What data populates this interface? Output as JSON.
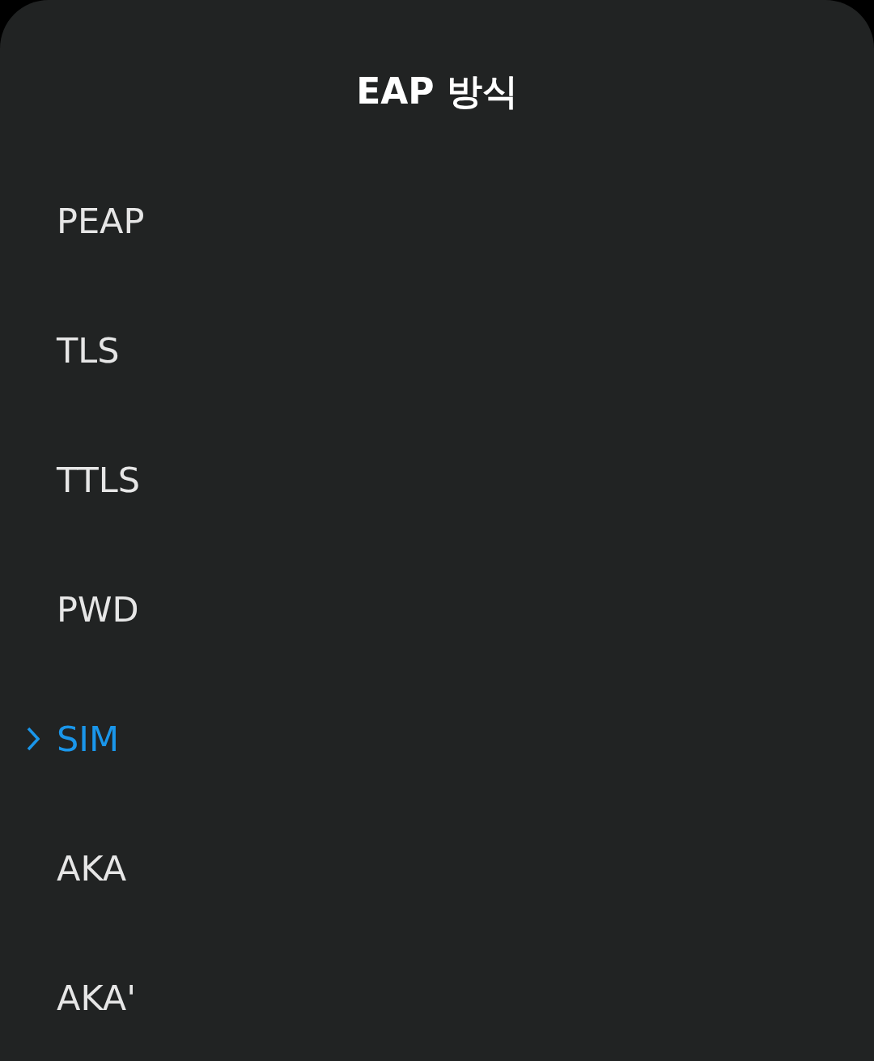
{
  "title": "EAP 방식",
  "options": [
    {
      "label": "PEAP",
      "selected": false
    },
    {
      "label": "TLS",
      "selected": false
    },
    {
      "label": "TTLS",
      "selected": false
    },
    {
      "label": "PWD",
      "selected": false
    },
    {
      "label": "SIM",
      "selected": true
    },
    {
      "label": "AKA",
      "selected": false
    },
    {
      "label": "AKA'",
      "selected": false
    }
  ]
}
